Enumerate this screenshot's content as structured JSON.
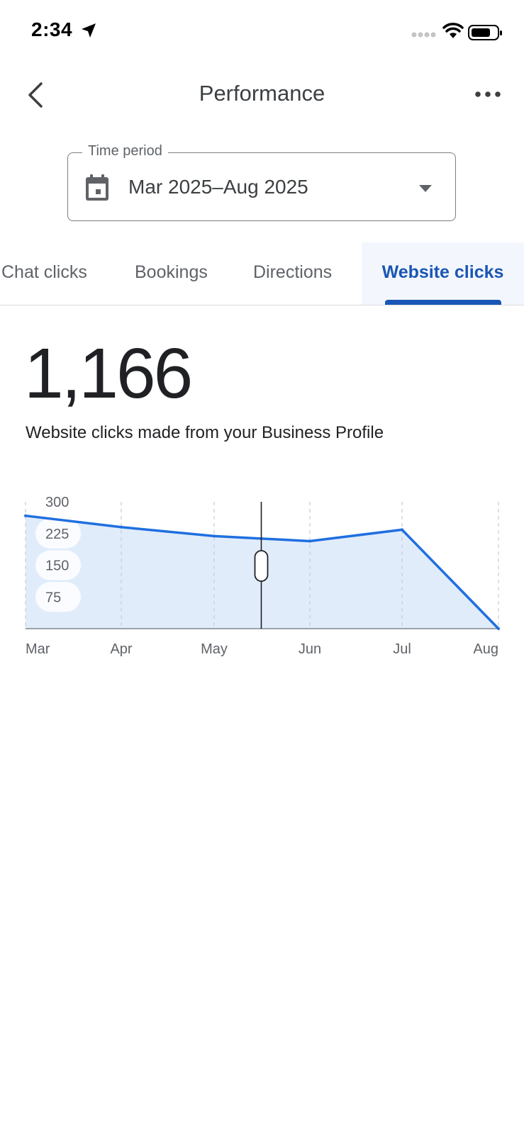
{
  "status_bar": {
    "time": "2:34"
  },
  "header": {
    "title": "Performance"
  },
  "time_period": {
    "label": "Time period",
    "value": "Mar 2025–Aug 2025"
  },
  "tabs": [
    {
      "label": "Chat clicks",
      "active": false
    },
    {
      "label": "Bookings",
      "active": false
    },
    {
      "label": "Directions",
      "active": false
    },
    {
      "label": "Website clicks",
      "active": true
    }
  ],
  "summary": {
    "total": "1,166",
    "description": "Website clicks made from your Business Profile"
  },
  "colors": {
    "accent": "#1a56b5",
    "line": "#1f6fe0",
    "area": "#e1ecfb"
  },
  "chart_data": {
    "type": "area",
    "x": [
      "Mar",
      "Apr",
      "May",
      "Jun",
      "Jul",
      "Aug"
    ],
    "xlabel": "",
    "ylabel": "",
    "y_ticks": [
      300,
      225,
      150,
      75
    ],
    "ylim": [
      0,
      300
    ],
    "series": [
      {
        "values": [
          267,
          240,
          219,
          207,
          234,
          0
        ]
      }
    ],
    "grid": "vertical dashed",
    "cursor_between": [
      "May",
      "Jun"
    ]
  }
}
